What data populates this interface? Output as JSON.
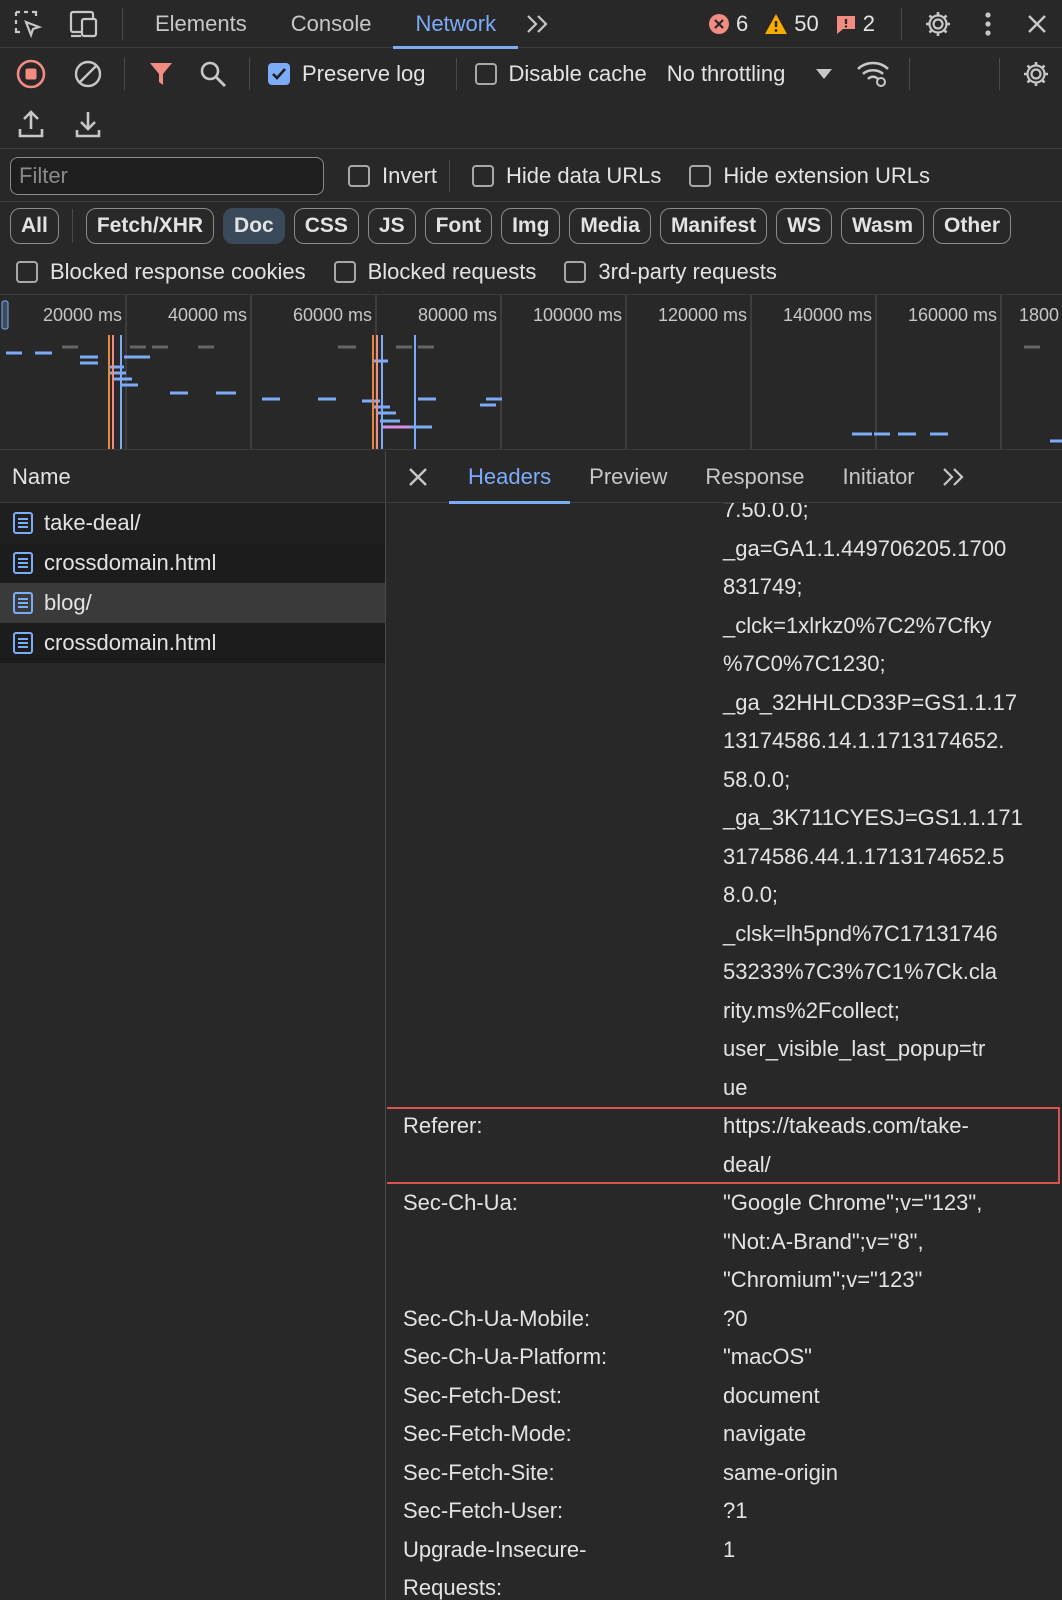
{
  "tabs": {
    "elements": "Elements",
    "console": "Console",
    "network": "Network"
  },
  "badges": {
    "errors": "6",
    "warnings": "50",
    "issues": "2"
  },
  "colors": {
    "accent": "#7cacf8",
    "error": "#f28b82",
    "warning": "#f9ab00",
    "highlight": "#d9534f"
  },
  "toolbar": {
    "preserve_log": "Preserve log",
    "disable_cache": "Disable cache",
    "throttling": "No throttling"
  },
  "filter": {
    "placeholder": "Filter",
    "invert": "Invert",
    "hide_data_urls": "Hide data URLs",
    "hide_extension_urls": "Hide extension URLs"
  },
  "types": [
    "All",
    "Fetch/XHR",
    "Doc",
    "CSS",
    "JS",
    "Font",
    "Img",
    "Media",
    "Manifest",
    "WS",
    "Wasm",
    "Other"
  ],
  "blocked": {
    "cookies": "Blocked response cookies",
    "requests": "Blocked requests",
    "third_party": "3rd-party requests"
  },
  "timeline": {
    "ticks": [
      "20000 ms",
      "40000 ms",
      "60000 ms",
      "80000 ms",
      "100000 ms",
      "120000 ms",
      "140000 ms",
      "160000 ms",
      "1800"
    ]
  },
  "requests": {
    "column": "Name",
    "items": [
      "take-deal/",
      "crossdomain.html",
      "blog/",
      "crossdomain.html"
    ]
  },
  "detail_tabs": {
    "headers": "Headers",
    "preview": "Preview",
    "response": "Response",
    "initiator": "Initiator"
  },
  "headers": [
    {
      "key": "",
      "lines": [
        "7.50.0.0;",
        "_ga=GA1.1.449706205.1700",
        "831749;",
        "_clck=1xlrkz0%7C2%7Cfky",
        "%7C0%7C1230;",
        "_ga_32HHLCD33P=GS1.1.17",
        "13174586.14.1.1713174652.",
        "58.0.0;",
        "_ga_3K711CYESJ=GS1.1.171",
        "3174586.44.1.1713174652.5",
        "8.0.0;",
        "_clsk=lh5pnd%7C17131746",
        "53233%7C3%7C1%7Ck.cla",
        "rity.ms%2Fcollect;",
        "user_visible_last_popup=tr",
        "ue"
      ]
    },
    {
      "key": "Referer:",
      "lines": [
        "https://takeads.com/take-",
        "deal/"
      ],
      "highlight": true
    },
    {
      "key": "Sec-Ch-Ua:",
      "lines": [
        "\"Google Chrome\";v=\"123\",",
        "\"Not:A-Brand\";v=\"8\",",
        "\"Chromium\";v=\"123\""
      ]
    },
    {
      "key": "Sec-Ch-Ua-Mobile:",
      "lines": [
        "?0"
      ]
    },
    {
      "key": "Sec-Ch-Ua-Platform:",
      "lines": [
        "\"macOS\""
      ]
    },
    {
      "key": "Sec-Fetch-Dest:",
      "lines": [
        "document"
      ]
    },
    {
      "key": "Sec-Fetch-Mode:",
      "lines": [
        "navigate"
      ]
    },
    {
      "key": "Sec-Fetch-Site:",
      "lines": [
        "same-origin"
      ]
    },
    {
      "key": "Sec-Fetch-User:",
      "lines": [
        "?1"
      ]
    },
    {
      "key": "Upgrade-Insecure-\nRequests:",
      "lines": [
        "1"
      ]
    }
  ]
}
